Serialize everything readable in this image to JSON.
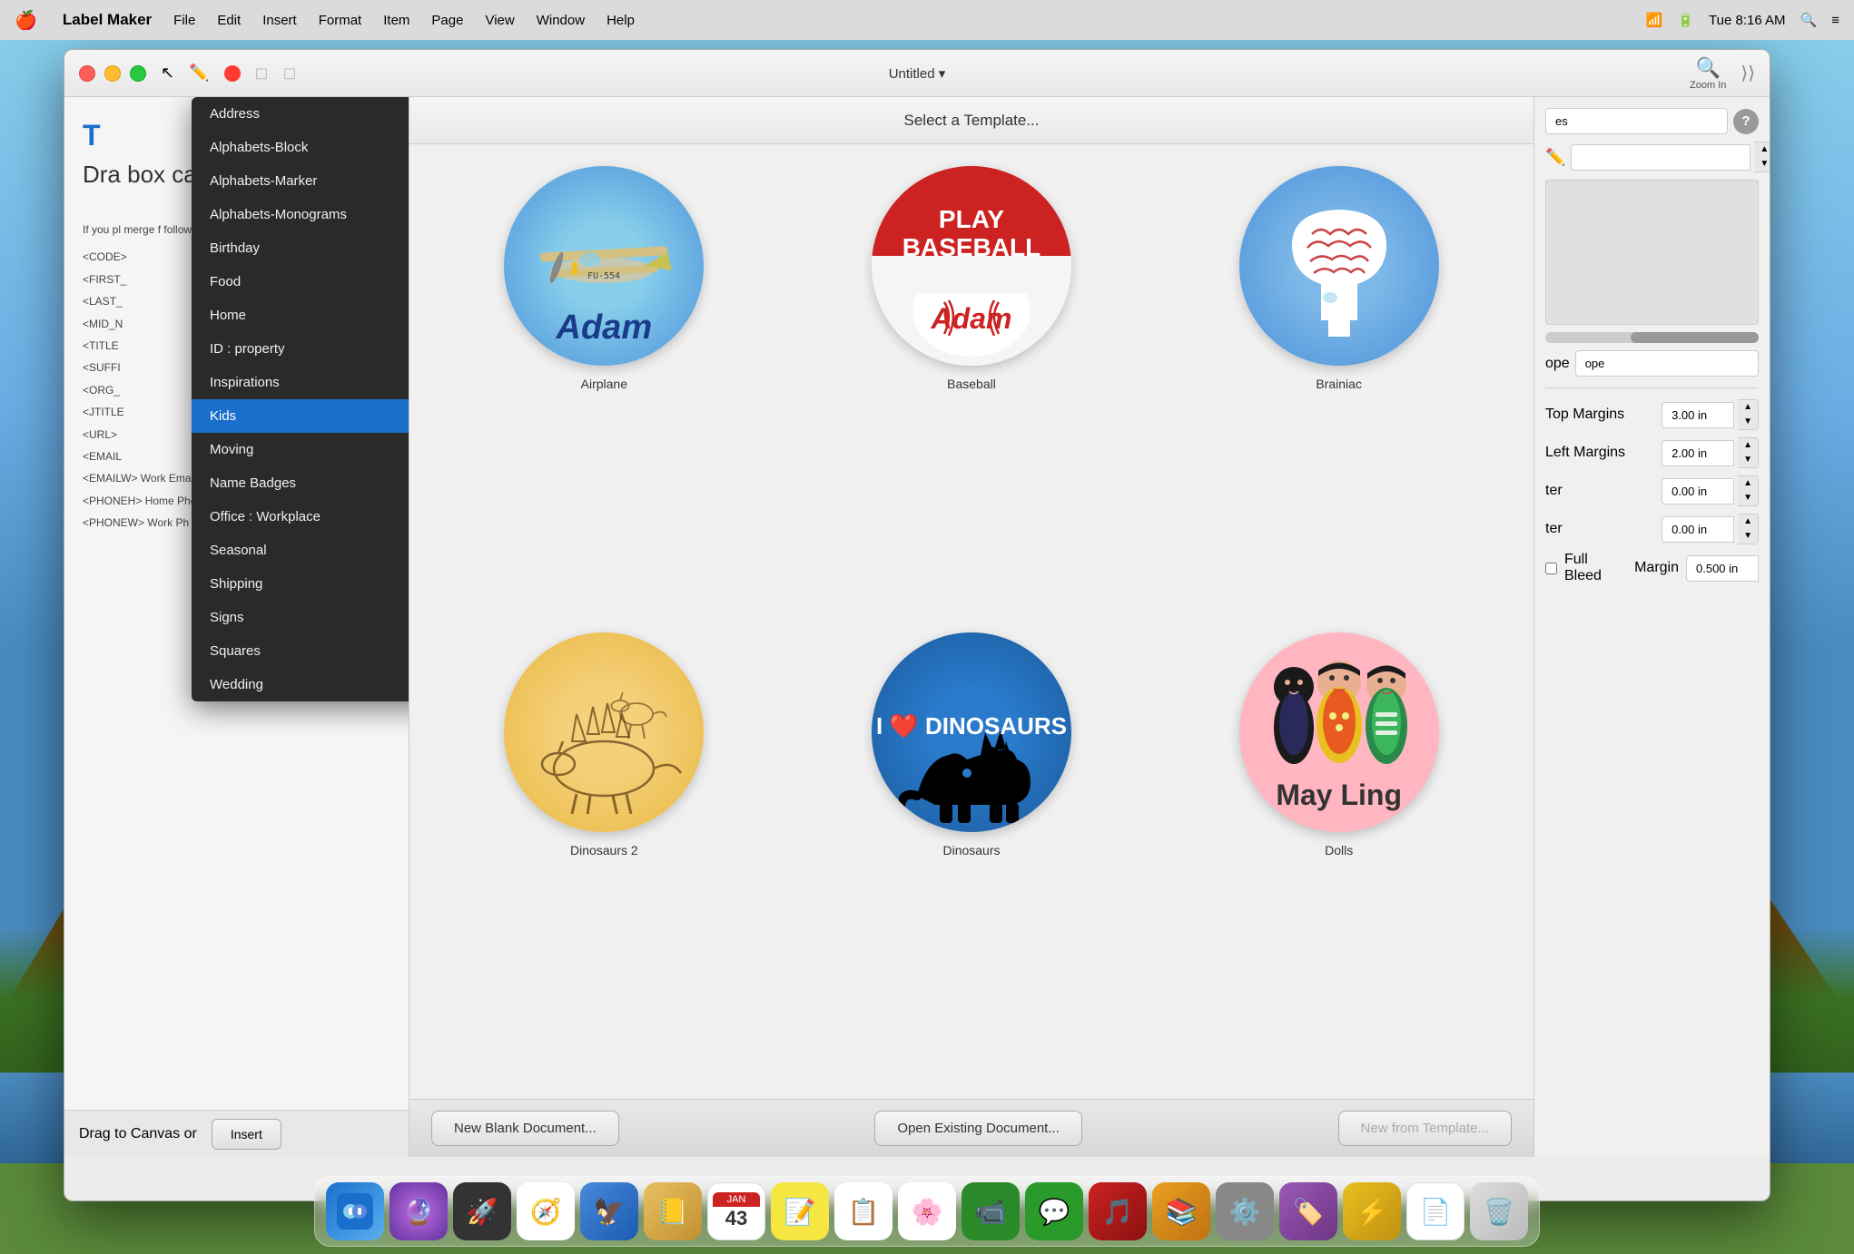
{
  "menubar": {
    "apple": "🍎",
    "appname": "Label Maker",
    "items": [
      "File",
      "Edit",
      "Insert",
      "Format",
      "Item",
      "Page",
      "View",
      "Window",
      "Help"
    ],
    "time": "Tue 8:16 AM"
  },
  "window": {
    "title": "Untitled ▾",
    "toolbar": {
      "zoom_label": "Zoom In"
    }
  },
  "template_selector": {
    "title": "Select a Template...",
    "templates": [
      {
        "name": "Airplane",
        "style": "airplane"
      },
      {
        "name": "Baseball",
        "style": "baseball"
      },
      {
        "name": "Brainiac",
        "style": "brainiac"
      },
      {
        "name": "Dinosaurs 2",
        "style": "dino2"
      },
      {
        "name": "Dinosaurs",
        "style": "dino"
      },
      {
        "name": "Dolls",
        "style": "dolls"
      }
    ],
    "footer": {
      "new_blank": "New Blank Document...",
      "open_existing": "Open Existing Document...",
      "new_from_template": "New from Template..."
    }
  },
  "dropdown": {
    "items": [
      "Address",
      "Alphabets-Block",
      "Alphabets-Marker",
      "Alphabets-Monograms",
      "Birthday",
      "Food",
      "Home",
      "ID : property",
      "Inspirations",
      "Kids",
      "Moving",
      "Name Badges",
      "Office : Workplace",
      "Seasonal",
      "Shipping",
      "Signs",
      "Squares",
      "Wedding"
    ],
    "selected": "Kids"
  },
  "right_panel": {
    "search_placeholder": "es",
    "size_label": "All Sizes",
    "shape_label": "ope",
    "top_margins_label": "Top Margins",
    "top_margins_value": "3.00 in",
    "left_margins_label": "Left Margins",
    "left_margins_value": "2.00 in",
    "gutter_label": "ter",
    "gutter_value": "0.00 in",
    "gutter2_value": "0.00 in",
    "full_bleed_label": "Full Bleed",
    "margin_label": "Margin",
    "margin_value": "0.500 in"
  },
  "left_panel": {
    "doc_text": "Dra box can it.",
    "merge_label": "If you pl merge f following they will you pri",
    "codes": [
      "<CODE>",
      "<FIRST_",
      "<LAST_",
      "<MID_N",
      "<TITLE",
      "<SUFFI",
      "<ORG_",
      "<JTITLE",
      "<URL>",
      "<EMAIL",
      "<EMAILW> Work Email",
      "<PHONEH> Home Phone",
      "<PHONEW> Work Ph"
    ],
    "drag_label": "Drag to Canvas or",
    "insert_label": "Insert"
  },
  "dock": {
    "icons": [
      {
        "name": "finder-icon",
        "emoji": "🟦",
        "color": "#1a6fcc"
      },
      {
        "name": "siri-icon",
        "emoji": "🔮",
        "color": "#9b59b6"
      },
      {
        "name": "launchpad-icon",
        "emoji": "🚀",
        "color": "#555"
      },
      {
        "name": "safari-icon",
        "emoji": "🧭",
        "color": "#1a6fcc"
      },
      {
        "name": "mail-icon",
        "emoji": "✉️",
        "color": "#1a6fcc"
      },
      {
        "name": "contacts-icon",
        "emoji": "📒",
        "color": "#e8c060"
      },
      {
        "name": "calendar-icon",
        "emoji": "📅",
        "color": "#cc2222"
      },
      {
        "name": "notes-icon",
        "emoji": "📝",
        "color": "#f5e642"
      },
      {
        "name": "reminders-icon",
        "emoji": "📋",
        "color": "#f0f0f0"
      },
      {
        "name": "photos-icon",
        "emoji": "🌸",
        "color": "#e87070"
      },
      {
        "name": "facetime-icon",
        "emoji": "📹",
        "color": "#2a9a2a"
      },
      {
        "name": "messages-icon",
        "emoji": "💬",
        "color": "#2a9a2a"
      },
      {
        "name": "music-icon",
        "emoji": "🎵",
        "color": "#cc2222"
      },
      {
        "name": "books-icon",
        "emoji": "📚",
        "color": "#e8a020"
      },
      {
        "name": "settings-icon",
        "emoji": "⚙️",
        "color": "#888"
      },
      {
        "name": "labelmaker-icon",
        "emoji": "🏷️",
        "color": "#9b59b6"
      },
      {
        "name": "reeder-icon",
        "emoji": "⚡",
        "color": "#e8c020"
      },
      {
        "name": "document-icon",
        "emoji": "📄",
        "color": "#f0f0f0"
      },
      {
        "name": "trash-icon",
        "emoji": "🗑️",
        "color": "#888"
      }
    ]
  }
}
